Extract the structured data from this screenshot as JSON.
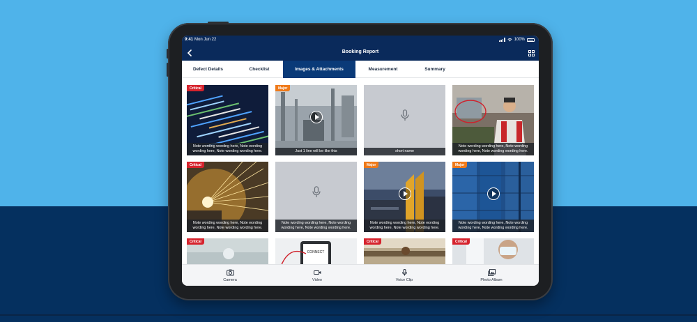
{
  "statusbar": {
    "time": "9:41",
    "date": "Mon Jun 22",
    "battery": "100%"
  },
  "navbar": {
    "title": "Booking Report"
  },
  "tabs": [
    {
      "label": "Defect Details",
      "active": false
    },
    {
      "label": "Checklist",
      "active": false
    },
    {
      "label": "Images & Attachments",
      "active": true
    },
    {
      "label": "Measurement",
      "active": false
    },
    {
      "label": "Summary",
      "active": false
    }
  ],
  "cards": [
    {
      "badge": "Critical",
      "type": "image",
      "icon": "code-screen-photo",
      "caption": "Note wording wording here, Note wording wording here, Note wording wording here."
    },
    {
      "badge": "Major",
      "type": "video",
      "icon": "factory-photo",
      "caption": "Just 1 line will be like this"
    },
    {
      "badge": "",
      "type": "audio",
      "icon": "mic-icon",
      "caption": "short name"
    },
    {
      "badge": "",
      "type": "image",
      "icon": "worker-photo",
      "caption": "Note wording wording here, Note wording wording here, Note wording wording here."
    },
    {
      "badge": "Critical",
      "type": "image",
      "icon": "grinding-sparks-photo",
      "caption": "Note wording wording here, Note wording wording here, Note wording wording here."
    },
    {
      "badge": "",
      "type": "audio",
      "icon": "mic-icon",
      "caption": "Note wording wording here, Note wording wording here, Note wording wording here."
    },
    {
      "badge": "Major",
      "type": "video",
      "icon": "industrial-building-photo",
      "caption": "Note wording wording here, Note wording wording here, Note wording wording here."
    },
    {
      "badge": "Major",
      "type": "video",
      "icon": "blue-tanks-photo",
      "caption": "Note wording wording here, Note wording wording here, Note wording wording here."
    },
    {
      "badge": "Critical",
      "type": "image",
      "icon": "lab-photo",
      "caption": ""
    },
    {
      "badge": "",
      "type": "image",
      "icon": "tablet-photo",
      "caption": "",
      "thumb_text": "CONNECT"
    },
    {
      "badge": "Critical",
      "type": "image",
      "icon": "workshop-photo",
      "caption": ""
    },
    {
      "badge": "Critical",
      "type": "image",
      "icon": "mask-worker-photo",
      "caption": ""
    }
  ],
  "bottombar": {
    "camera": "Camera",
    "video": "Video",
    "voice_clip": "Voice Clip",
    "photo_album": "Photo Album"
  },
  "colors": {
    "navy": "#0a2a5b",
    "tab_active": "#0a3a78",
    "critical": "#d6232d",
    "major": "#ef7a1a"
  }
}
